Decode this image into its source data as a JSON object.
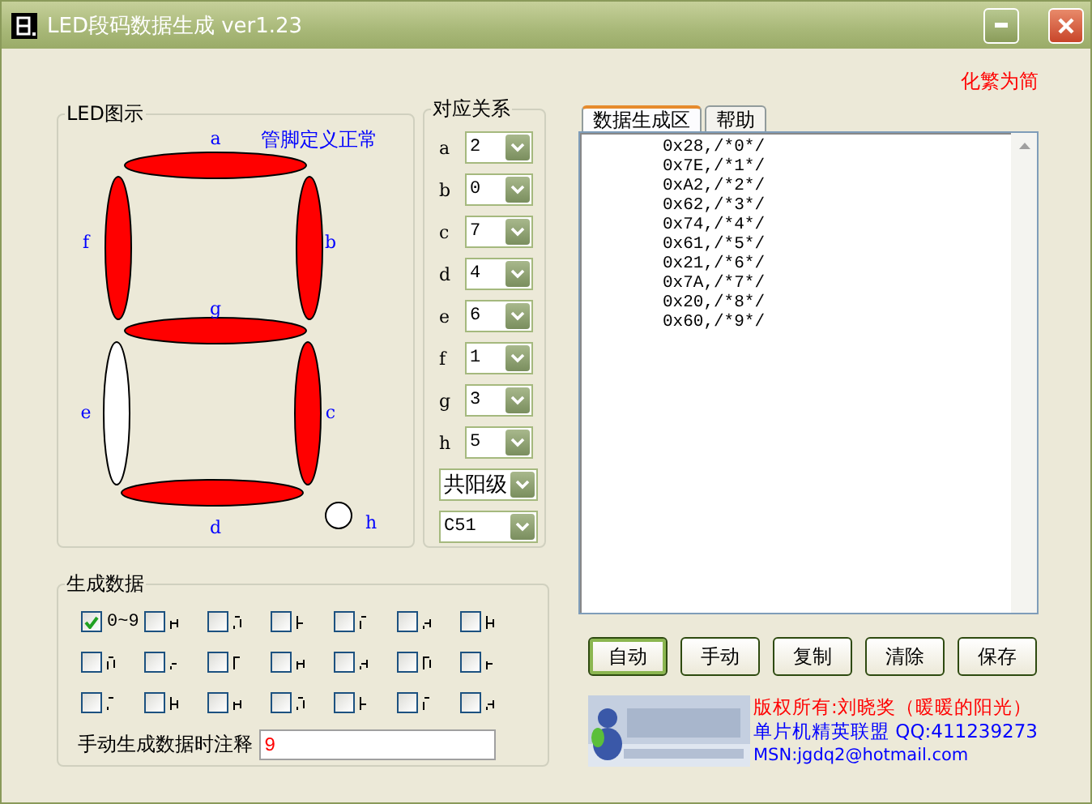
{
  "window": {
    "title": "LED段码数据生成 ver1.23"
  },
  "lang_link": "化繁为简",
  "led_group": {
    "title": "LED图示",
    "status": "管脚定义正常",
    "segments": [
      {
        "label": "a",
        "lit": true
      },
      {
        "label": "b",
        "lit": true
      },
      {
        "label": "c",
        "lit": true
      },
      {
        "label": "d",
        "lit": true
      },
      {
        "label": "e",
        "lit": false
      },
      {
        "label": "f",
        "lit": true
      },
      {
        "label": "g",
        "lit": true
      },
      {
        "label": "h",
        "lit": false
      }
    ]
  },
  "mapping_group": {
    "title": "对应关系",
    "rows": [
      {
        "label": "a",
        "value": "2"
      },
      {
        "label": "b",
        "value": "0"
      },
      {
        "label": "c",
        "value": "7"
      },
      {
        "label": "d",
        "value": "4"
      },
      {
        "label": "e",
        "value": "6"
      },
      {
        "label": "f",
        "value": "1"
      },
      {
        "label": "g",
        "value": "3"
      },
      {
        "label": "h",
        "value": "5"
      }
    ],
    "polarity": "共阳级",
    "compiler": "C51"
  },
  "generate_group": {
    "title": "生成数据",
    "options": [
      {
        "kind": "text",
        "label": "0~9",
        "checked": true
      },
      {
        "kind": "glyph",
        "checked": false
      },
      {
        "kind": "glyph",
        "checked": false
      },
      {
        "kind": "glyph",
        "checked": false
      },
      {
        "kind": "glyph",
        "checked": false
      },
      {
        "kind": "glyph",
        "checked": false
      },
      {
        "kind": "glyph",
        "checked": false
      },
      {
        "kind": "glyph",
        "checked": false
      },
      {
        "kind": "glyph",
        "checked": false
      },
      {
        "kind": "glyph",
        "checked": false
      },
      {
        "kind": "glyph",
        "checked": false
      },
      {
        "kind": "glyph",
        "checked": false
      },
      {
        "kind": "glyph",
        "checked": false
      },
      {
        "kind": "glyph",
        "checked": false
      },
      {
        "kind": "glyph",
        "checked": false
      },
      {
        "kind": "glyph",
        "checked": false
      },
      {
        "kind": "glyph",
        "checked": false
      },
      {
        "kind": "glyph",
        "checked": false
      },
      {
        "kind": "glyph",
        "checked": false
      },
      {
        "kind": "glyph",
        "checked": false
      },
      {
        "kind": "glyph",
        "checked": false
      }
    ],
    "comment_label": "手动生成数据时注释",
    "comment_value": "9"
  },
  "tabs": [
    {
      "label": "数据生成区",
      "selected": true
    },
    {
      "label": "帮助",
      "selected": false
    }
  ],
  "output_lines": [
    "0x28,/*0*/",
    "0x7E,/*1*/",
    "0xA2,/*2*/",
    "0x62,/*3*/",
    "0x74,/*4*/",
    "0x61,/*5*/",
    "0x21,/*6*/",
    "0x7A,/*7*/",
    "0x20,/*8*/",
    "0x60,/*9*/"
  ],
  "buttons": [
    {
      "label": "自动",
      "selected": true
    },
    {
      "label": "手动",
      "selected": false
    },
    {
      "label": "复制",
      "selected": false
    },
    {
      "label": "清除",
      "selected": false
    },
    {
      "label": "保存",
      "selected": false
    }
  ],
  "footer": {
    "copyright": "版权所有:刘晓奖（暖暖的阳光）",
    "contact": "单片机精英联盟 QQ:411239273",
    "msn": "MSN:jgdq2@hotmail.com"
  }
}
